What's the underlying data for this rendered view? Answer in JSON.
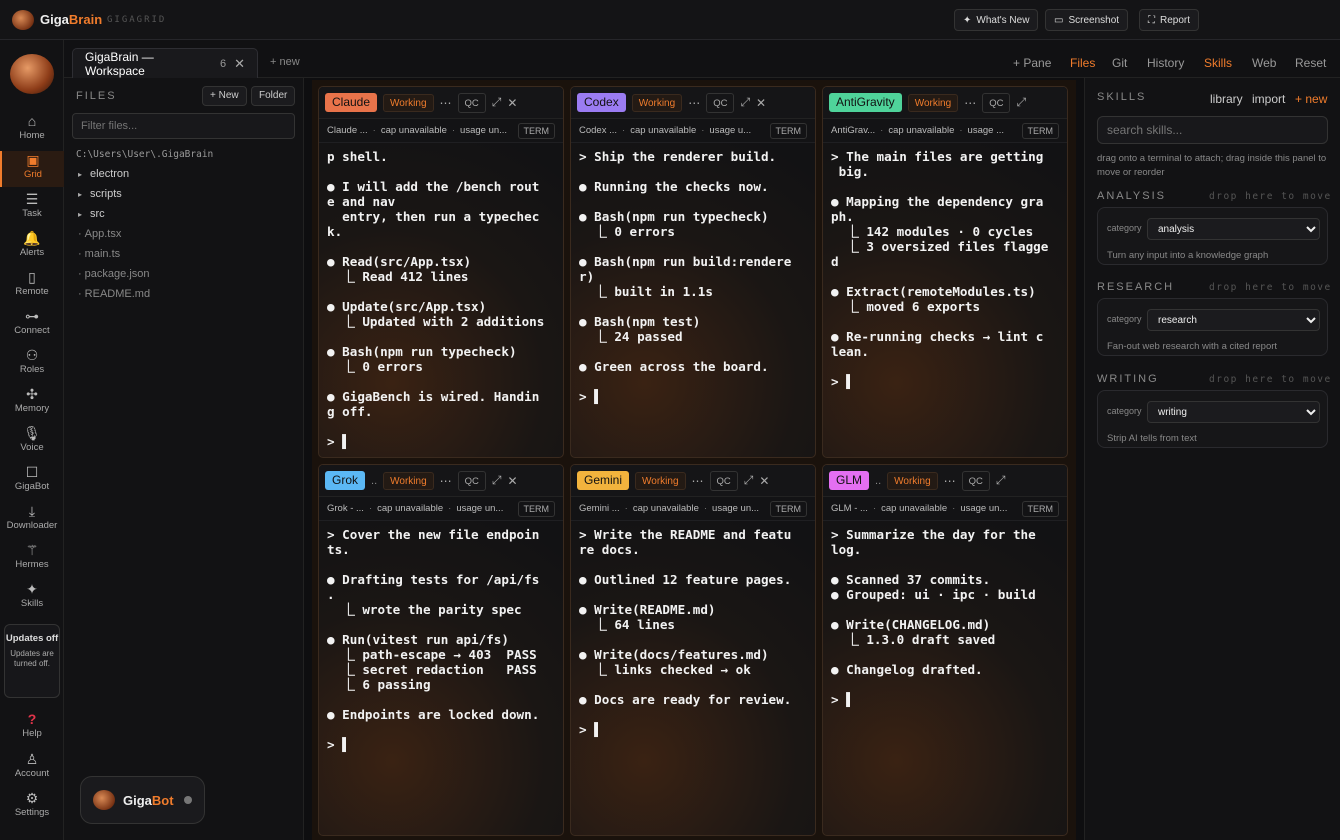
{
  "topbar": {
    "brand_a": "Giga",
    "brand_b": "Brain",
    "sub": "GIGAGRID",
    "whats_new": "What's New",
    "screenshot": "Screenshot",
    "report": "Report"
  },
  "rail": [
    {
      "label": "Home",
      "icon": "⌂"
    },
    {
      "label": "Grid",
      "icon": "▣"
    },
    {
      "label": "Task",
      "icon": "☰"
    },
    {
      "label": "Alerts",
      "icon": "🔔"
    },
    {
      "label": "Remote",
      "icon": "▯"
    },
    {
      "label": "Connect",
      "icon": "⊶"
    },
    {
      "label": "Roles",
      "icon": "⚇"
    },
    {
      "label": "Memory",
      "icon": "✣"
    },
    {
      "label": "Voice",
      "icon": "🎙"
    },
    {
      "label": "GigaBot",
      "icon": "☐"
    },
    {
      "label": "Downloader",
      "icon": "⤓"
    },
    {
      "label": "Hermes",
      "icon": "⚚"
    },
    {
      "label": "Skills",
      "icon": "✦"
    }
  ],
  "updates": {
    "title": "Updates off",
    "sub": "Updates are turned off."
  },
  "rail_bottom": [
    {
      "label": "Help",
      "icon": "?"
    },
    {
      "label": "Account",
      "icon": "♙"
    },
    {
      "label": "Settings",
      "icon": "⚙"
    }
  ],
  "tabs": {
    "workspace": "GigaBrain — Workspace",
    "count": "6",
    "new": "+ new",
    "pane": "+ Pane",
    "files": "Files",
    "git": "Git",
    "history": "History",
    "skills": "Skills",
    "web": "Web",
    "reset": "Reset"
  },
  "files": {
    "title": "FILES",
    "new_btn": "+ New",
    "folder_btn": "Folder",
    "filter_placeholder": "Filter files...",
    "path": "C:\\Users\\User\\.GigaBrain",
    "folders": [
      "electron",
      "scripts",
      "src"
    ],
    "entries": [
      "App.tsx",
      "main.ts",
      "package.json",
      "README.md"
    ]
  },
  "gigabot": {
    "a": "Giga",
    "b": "Bot"
  },
  "panes": [
    {
      "name": "Claude",
      "color": "#e8734a",
      "status": "Working",
      "qc": "QC",
      "sub": "Claude ...",
      "cap": "cap unavailable",
      "usage": "usage un...",
      "term": "TERM",
      "body": "p shell.\n\n● I will add the /bench rout\ne and nav\n  entry, then run a typechec\nk.\n\n● Read(src/App.tsx)\n  ⎿ Read 412 lines\n\n● Update(src/App.tsx)\n  ⎿ Updated with 2 additions\n\n● Bash(npm run typecheck)\n  ⎿ 0 errors\n\n● GigaBench is wired. Handin\ng off.\n\n> ▌"
    },
    {
      "name": "Codex",
      "color": "#9b7cf2",
      "status": "Working",
      "qc": "QC",
      "sub": "Codex ...",
      "cap": "cap unavailable",
      "usage": "usage u...",
      "term": "TERM",
      "body": "> Ship the renderer build.\n\n● Running the checks now.\n\n● Bash(npm run typecheck)\n  ⎿ 0 errors\n\n● Bash(npm run build:rendere\nr)\n  ⎿ built in 1.1s\n\n● Bash(npm test)\n  ⎿ 24 passed\n\n● Green across the board.\n\n> ▌"
    },
    {
      "name": "AntiGravity",
      "color": "#4fd39a",
      "status": "Working",
      "qc": "QC",
      "sub": "AntiGrav...",
      "cap": "cap unavailable",
      "usage": "usage ...",
      "term": "TERM",
      "body": "> The main files are getting\n big.\n\n● Mapping the dependency gra\nph.\n  ⎿ 142 modules · 0 cycles\n  ⎿ 3 oversized files flagge\nd\n\n● Extract(remoteModules.ts)\n  ⎿ moved 6 exports\n\n● Re-running checks → lint c\nlean.\n\n> ▌"
    },
    {
      "name": "Grok",
      "color": "#5bb8f5",
      "status": "Working",
      "qc": "QC",
      "sub": "Grok - ...",
      "cap": "cap unavailable",
      "usage": "usage un...",
      "term": "TERM",
      "body": "> Cover the new file endpoin\nts.\n\n● Drafting tests for /api/fs\n.\n  ⎿ wrote the parity spec\n\n● Run(vitest run api/fs)\n  ⎿ path-escape → 403  PASS\n  ⎿ secret redaction   PASS\n  ⎿ 6 passing\n\n● Endpoints are locked down.\n\n> ▌"
    },
    {
      "name": "Gemini",
      "color": "#f2b33d",
      "status": "Working",
      "qc": "QC",
      "sub": "Gemini ...",
      "cap": "cap unavailable",
      "usage": "usage un...",
      "term": "TERM",
      "body": "> Write the README and featu\nre docs.\n\n● Outlined 12 feature pages.\n\n● Write(README.md)\n  ⎿ 64 lines\n\n● Write(docs/features.md)\n  ⎿ links checked → ok\n\n● Docs are ready for review.\n\n> ▌"
    },
    {
      "name": "GLM",
      "color": "#e46ff2",
      "status": "Working",
      "qc": "QC",
      "sub": "GLM - ...",
      "cap": "cap unavailable",
      "usage": "usage un...",
      "term": "TERM",
      "body": "> Summarize the day for the\nlog.\n\n● Scanned 37 commits.\n● Grouped: ui · ipc · build\n\n● Write(CHANGELOG.md)\n  ⎿ 1.3.0 draft saved\n\n● Changelog drafted.\n\n> ▌"
    }
  ],
  "skills": {
    "title": "SKILLS",
    "library": "library",
    "import": "import",
    "new": "+ new",
    "search_placeholder": "search skills...",
    "help": "drag onto a terminal to attach; drag inside this panel to move or reorder",
    "drop": "drop here to move",
    "category_label": "category",
    "categories": [
      {
        "head": "ANALYSIS",
        "value": "analysis",
        "desc": "Turn any input into a knowledge graph"
      },
      {
        "head": "RESEARCH",
        "value": "research",
        "desc": "Fan-out web research with a cited report"
      },
      {
        "head": "WRITING",
        "value": "writing",
        "desc": "Strip AI tells from text"
      }
    ]
  }
}
